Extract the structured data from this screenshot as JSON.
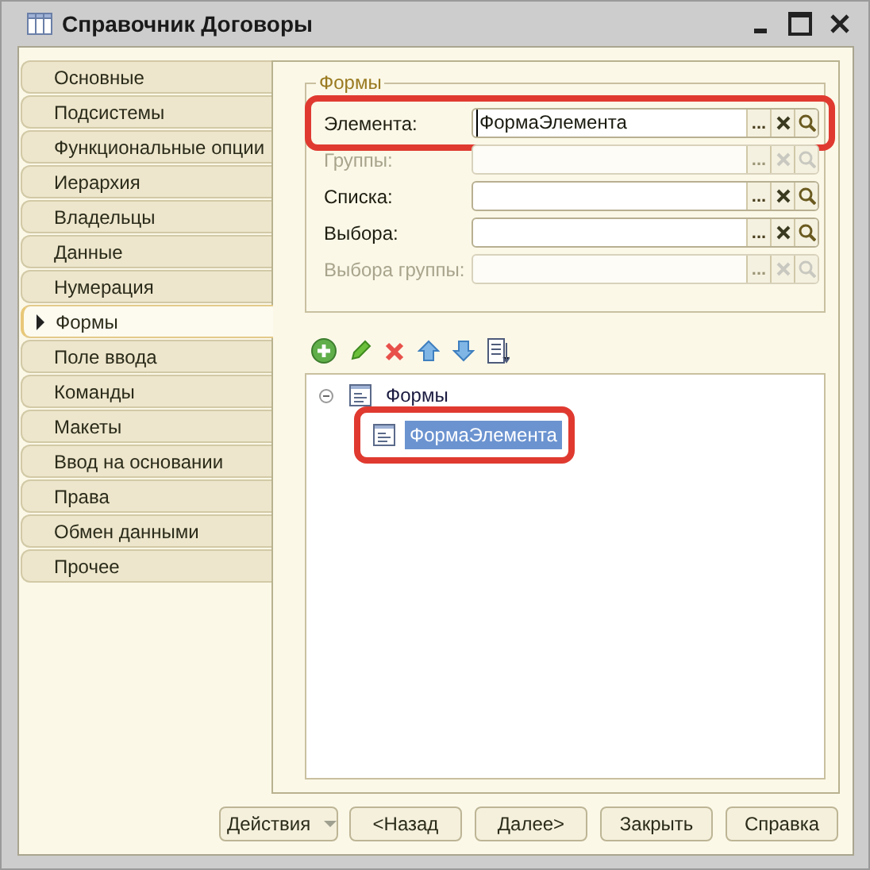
{
  "window": {
    "title": "Справочник Договоры"
  },
  "sidebar": {
    "items": [
      {
        "label": "Основные",
        "selected": false
      },
      {
        "label": "Подсистемы",
        "selected": false
      },
      {
        "label": "Функциональные опции",
        "selected": false
      },
      {
        "label": "Иерархия",
        "selected": false
      },
      {
        "label": "Владельцы",
        "selected": false
      },
      {
        "label": "Данные",
        "selected": false
      },
      {
        "label": "Нумерация",
        "selected": false
      },
      {
        "label": "Формы",
        "selected": true
      },
      {
        "label": "Поле ввода",
        "selected": false
      },
      {
        "label": "Команды",
        "selected": false
      },
      {
        "label": "Макеты",
        "selected": false
      },
      {
        "label": "Ввод на основании",
        "selected": false
      },
      {
        "label": "Права",
        "selected": false
      },
      {
        "label": "Обмен данными",
        "selected": false
      },
      {
        "label": "Прочее",
        "selected": false
      }
    ]
  },
  "forms_group": {
    "title": "Формы",
    "fields": [
      {
        "label": "Элемента:",
        "value": "ФормаЭлемента",
        "disabled": false,
        "highlighted": true
      },
      {
        "label": "Группы:",
        "disabled": true,
        "highlighted": false
      },
      {
        "label": "Списка:",
        "disabled": false,
        "highlighted": false
      },
      {
        "label": "Выбора:",
        "disabled": false,
        "highlighted": false
      },
      {
        "label": "Выбора группы:",
        "disabled": true,
        "highlighted": false
      }
    ],
    "ellipsis": "..."
  },
  "tree": {
    "root": {
      "label": "Формы",
      "expanded": true,
      "children": [
        {
          "label": "ФормаЭлемента",
          "selected": true,
          "highlighted": true
        }
      ]
    }
  },
  "footer_buttons": [
    {
      "label": "Действия",
      "kind": "dropdown"
    },
    {
      "label": "<Назад",
      "kind": "plain"
    },
    {
      "label": "Далее>",
      "kind": "plain"
    },
    {
      "label": "Закрыть",
      "kind": "plain"
    },
    {
      "label": "Справка",
      "kind": "plain"
    }
  ]
}
